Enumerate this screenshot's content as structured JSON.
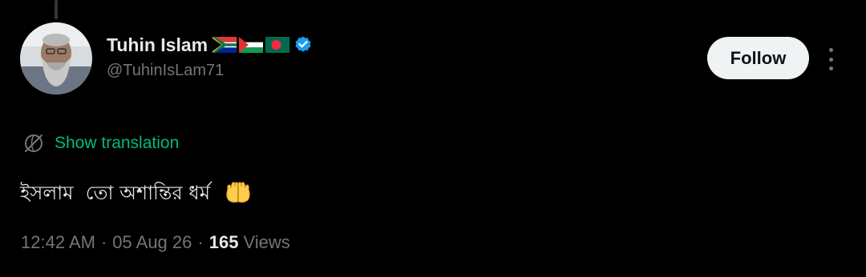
{
  "tweet": {
    "author": {
      "display_name": "Tuhin Islam",
      "handle": "@TuhinIsLam71",
      "flags": [
        "south-africa-flag",
        "palestine-flag",
        "bangladesh-flag"
      ],
      "verified_icon": "verified-badge-icon",
      "verified_color": "#1d9bf0"
    },
    "follow_label": "Follow",
    "more_icon": "more-vertical-icon",
    "translation": {
      "icon": "globe-icon",
      "label": "Show translation",
      "color": "#00ba7c"
    },
    "text": "ইসলাম  তো অশান্তির ধর্ম",
    "emoji": "palms-up-together-emoji",
    "meta": {
      "time": "12:42 AM",
      "date": "05 Aug 26",
      "views_count": "165",
      "views_label": "Views",
      "separator": "·"
    }
  },
  "colors": {
    "background": "#000000",
    "primary_text": "#e7e9ea",
    "secondary_text": "#71767b",
    "button_bg": "#eff3f4",
    "button_text": "#0f1419"
  }
}
